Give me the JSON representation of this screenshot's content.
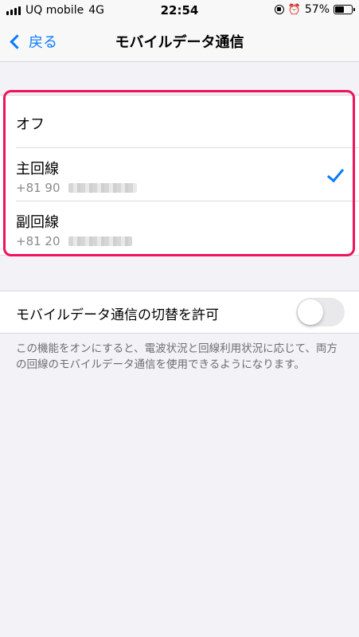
{
  "status_bar": {
    "carrier": "UQ mobile",
    "network": "4G",
    "time": "22:54",
    "battery": "57%",
    "battery_level": 0.57
  },
  "nav": {
    "back_label": "戻る",
    "title": "モバイルデータ通信"
  },
  "lines": {
    "off_label": "オフ",
    "primary": {
      "label": "主回線",
      "number_prefix": "+81 90",
      "selected": true
    },
    "secondary": {
      "label": "副回線",
      "number_prefix": "+81 20",
      "selected": false
    }
  },
  "switching": {
    "label": "モバイルデータ通信の切替を許可",
    "enabled": false,
    "description": "この機能をオンにすると、電波状況と回線利用状況に応じて、両方の回線のモバイルデータ通信を使用できるようになります。"
  },
  "colors": {
    "accent": "#0a7aff",
    "highlight": "#f0125c",
    "background": "#f2f2f7"
  }
}
